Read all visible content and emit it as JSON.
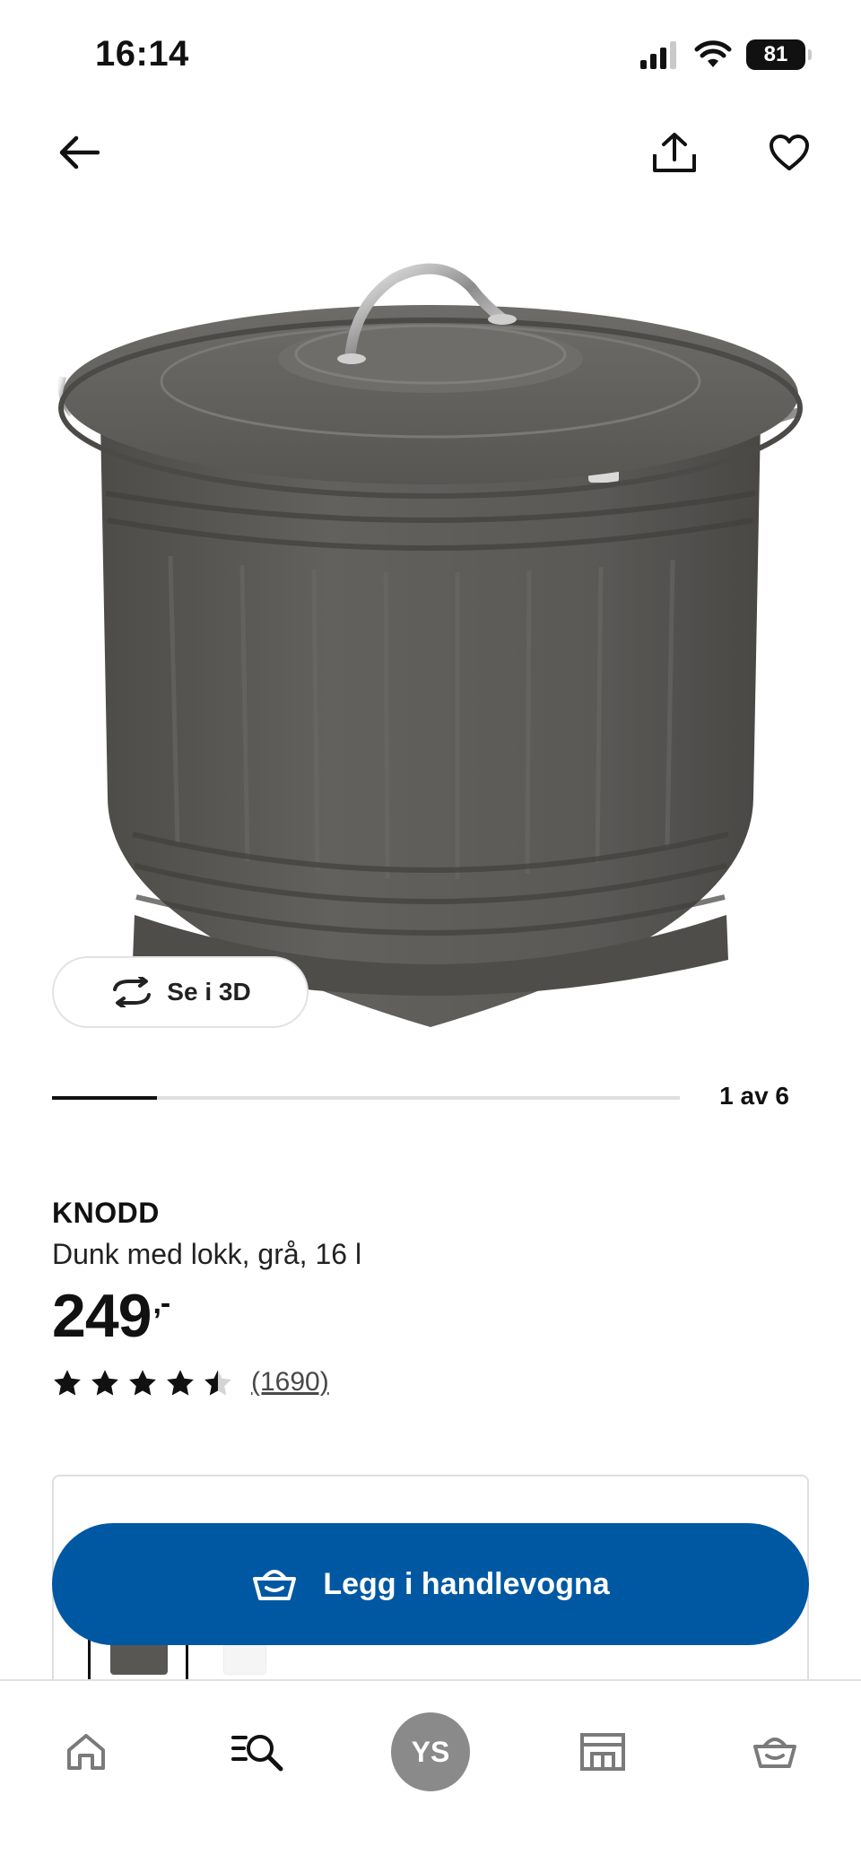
{
  "status_bar": {
    "time": "16:14",
    "battery_level": "81",
    "icons": [
      "cellular-signal-icon",
      "wifi-icon",
      "battery-icon"
    ]
  },
  "top_nav": {
    "icons": [
      "back-arrow-icon",
      "share-icon",
      "heart-icon"
    ]
  },
  "media": {
    "see_3d_label": "Se i 3D",
    "slide_counter": "1 av 6",
    "slide_progress": 0.167
  },
  "product": {
    "name": "KNODD",
    "description": "Dunk med lokk, grå, 16 l",
    "price": "249",
    "price_suffix": ",-",
    "rating": 4.5,
    "rating_max": 5,
    "review_count": "(1690)"
  },
  "cta": {
    "add_to_cart_label": "Legg i handlevogna"
  },
  "tab_bar": {
    "avatar_initials": "YS",
    "tabs": [
      "home-icon",
      "browse-search-icon",
      "profile-avatar",
      "store-icon",
      "cart-icon"
    ]
  },
  "colors": {
    "primary_blue": "#0058a3",
    "product_grey": "#5a5855",
    "avatar_grey": "#8a8a8a"
  }
}
